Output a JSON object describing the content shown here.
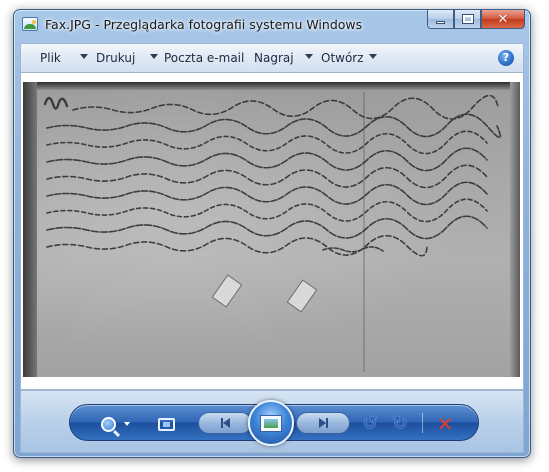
{
  "window": {
    "title": "Fax.JPG - Przeglądarka fotografii systemu Windows",
    "app_icon": "photo-viewer-icon",
    "buttons": {
      "minimize_icon": "minimize-icon",
      "maximize_icon": "maximize-icon",
      "close_icon": "close-icon",
      "close_glyph": "✕"
    }
  },
  "menubar": {
    "items": [
      {
        "label": "Plik",
        "has_dropdown": true
      },
      {
        "label": "Drukuj",
        "has_dropdown": true
      },
      {
        "label": "Poczta e-mail",
        "has_dropdown": false
      },
      {
        "label": "Nagraj",
        "has_dropdown": true
      },
      {
        "label": "Otwórz",
        "has_dropdown": true
      }
    ],
    "help": {
      "icon": "help-icon",
      "glyph": "?"
    }
  },
  "viewer": {
    "image_description_icon": "scanned-document-image"
  },
  "toolbar": {
    "buttons": [
      {
        "name": "zoom",
        "icon": "zoom-icon"
      },
      {
        "name": "actual-size",
        "icon": "fit-to-window-icon"
      },
      {
        "name": "previous",
        "icon": "previous-icon"
      },
      {
        "name": "slideshow",
        "icon": "slideshow-icon"
      },
      {
        "name": "next",
        "icon": "next-icon"
      },
      {
        "name": "rotate-counterclockwise",
        "icon": "rotate-left-icon",
        "glyph": "↺"
      },
      {
        "name": "rotate-clockwise",
        "icon": "rotate-right-icon",
        "glyph": "↻"
      },
      {
        "name": "delete",
        "icon": "delete-icon",
        "glyph": "✕"
      }
    ]
  },
  "colors": {
    "frame": "#8fb3dc",
    "delete": "#e33a2a",
    "accent": "#2f66b6"
  }
}
